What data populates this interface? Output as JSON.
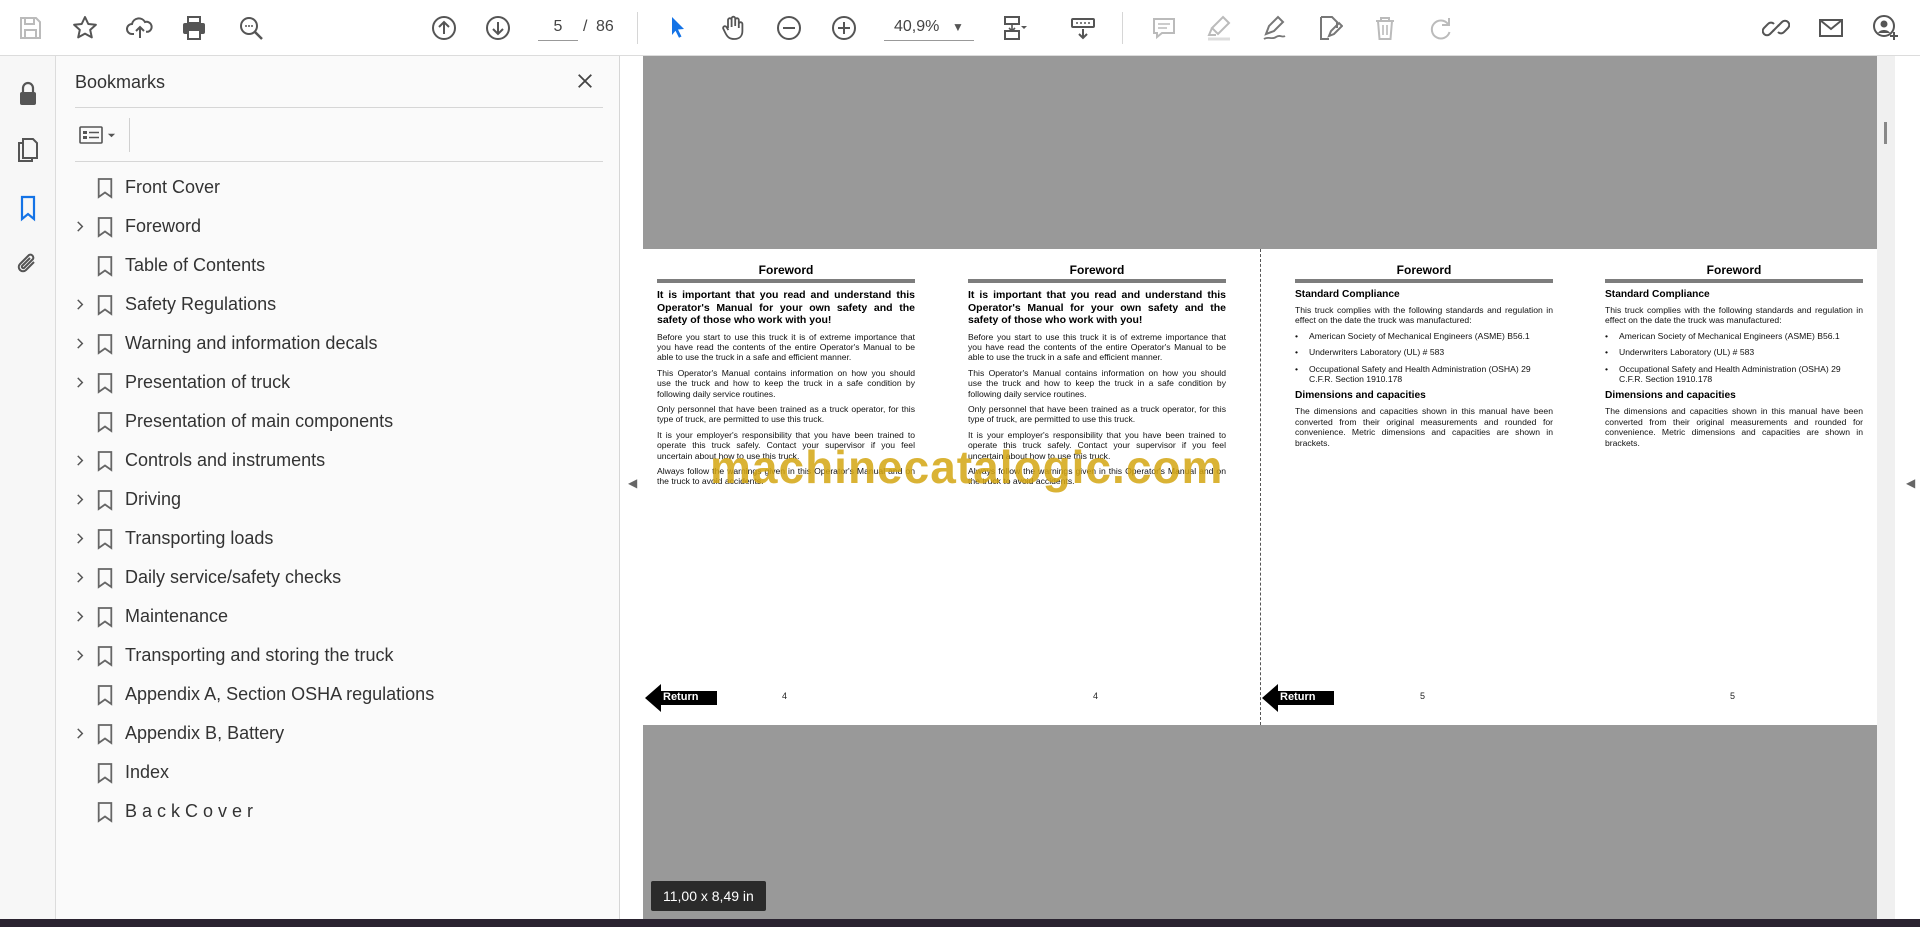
{
  "toolbar": {
    "page_current": "5",
    "page_separator": "/",
    "page_total": "86",
    "zoom": "40,9%"
  },
  "bookmarks": {
    "title": "Bookmarks",
    "items": [
      {
        "label": "Front Cover",
        "expandable": false
      },
      {
        "label": "Foreword",
        "expandable": true
      },
      {
        "label": "Table of Contents",
        "expandable": false
      },
      {
        "label": "Safety Regulations",
        "expandable": true
      },
      {
        "label": "Warning and information decals",
        "expandable": true
      },
      {
        "label": "Presentation of truck",
        "expandable": true
      },
      {
        "label": "Presentation of main components",
        "expandable": false
      },
      {
        "label": "Controls and instruments",
        "expandable": true
      },
      {
        "label": "Driving",
        "expandable": true
      },
      {
        "label": "Transporting loads",
        "expandable": true
      },
      {
        "label": "Daily service/safety checks",
        "expandable": true
      },
      {
        "label": "Maintenance",
        "expandable": true
      },
      {
        "label": "Transporting and storing the truck",
        "expandable": true
      },
      {
        "label": "Appendix A, Section OSHA regulations",
        "expandable": false
      },
      {
        "label": "Appendix B, Battery",
        "expandable": true
      },
      {
        "label": "Index",
        "expandable": false
      },
      {
        "label": "B a c k C o v e r",
        "expandable": false
      }
    ]
  },
  "document": {
    "page4": {
      "header": "Foreword",
      "lead": "It is important that you read and understand this Operator's Manual for your own safety and the safety of those who work with you!",
      "p1": "Before you start to use this truck it is of extreme importance that you have read the contents of the entire Operator's Manual to be able to use the truck in a safe and efficient manner.",
      "p2": "This Operator's Manual contains information on how you should use the truck and how to keep the truck in a safe condition by following daily service routines.",
      "p3": "Only personnel that have been trained as a truck operator, for this type of truck, are permitted to use this truck.",
      "p4": "It is your employer's responsibility that you have been trained to operate this truck safely. Contact your supervisor if you feel uncertain about how to use this truck.",
      "p5": "Always follow the warnings given in this Operator's Manual and on the truck to avoid accidents.",
      "page_number": "4",
      "return_label": "Return"
    },
    "page5": {
      "header": "Foreword",
      "h1": "Standard Compliance",
      "p1": "This truck complies with the following standards and regulation in effect on the date the truck was manufactured:",
      "li1": "American Society of Mechanical Engineers (ASME) B56.1",
      "li2": "Underwriters Laboratory (UL) # 583",
      "li3": "Occupational Safety and Health Administration (OSHA) 29 C.F.R. Section 1910.178",
      "h2": "Dimensions and capacities",
      "p2": "The dimensions and capacities shown in this manual have been converted from their original measurements and rounded for convenience. Metric dimensions and capacities are shown in brackets.",
      "page_number": "5",
      "return_label": "Return"
    },
    "watermark": "machinecatalogic.com",
    "page_size": "11,00 x 8,49 in"
  },
  "colors": {
    "accent": "#1473e6",
    "doc_background": "#999999",
    "watermark": "#d4a612"
  }
}
